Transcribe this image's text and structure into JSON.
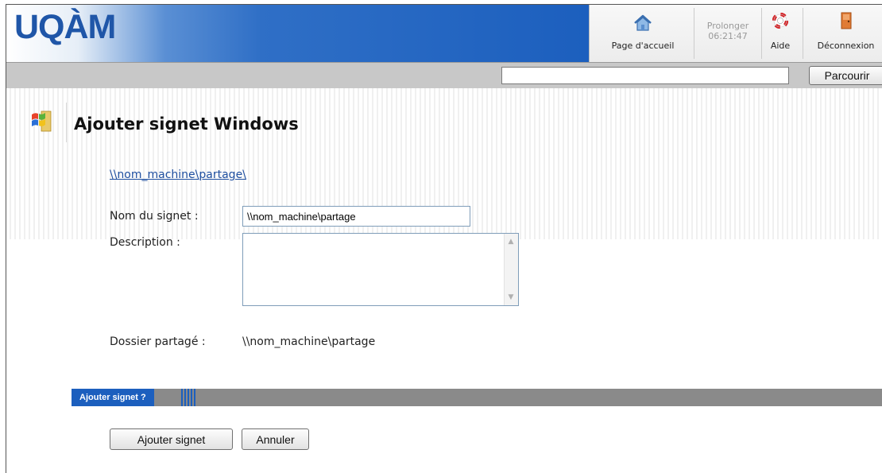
{
  "header": {
    "logo": "UQÀM",
    "toolbar": {
      "home_label": "Page d'accueil",
      "extend_label": "Prolonger",
      "timer": "06:21:47",
      "help_label": "Aide",
      "logout_label": "Déconnexion"
    }
  },
  "nav": {
    "url_value": "",
    "browse_label": "Parcourir"
  },
  "page": {
    "title": "Ajouter signet Windows",
    "path_link": "\\\\nom_machine\\partage\\"
  },
  "form": {
    "name_label": "Nom du signet :",
    "name_value": "\\\\nom_machine\\partage",
    "description_label": "Description :",
    "description_value": "",
    "shared_label": "Dossier partagé :",
    "shared_value": "\\\\nom_machine\\partage"
  },
  "section": {
    "tab_label": "Ajouter signet ?"
  },
  "actions": {
    "add_label": "Ajouter signet",
    "cancel_label": "Annuler"
  },
  "colors": {
    "brand_blue": "#1c5fbe",
    "logo_blue": "#1f56a8",
    "link_blue": "#1f4fa0",
    "bar_grey": "#c8c8c8"
  },
  "icons": [
    "home-icon",
    "lifebuoy-icon",
    "door-exit-icon",
    "windows-logo-icon"
  ]
}
